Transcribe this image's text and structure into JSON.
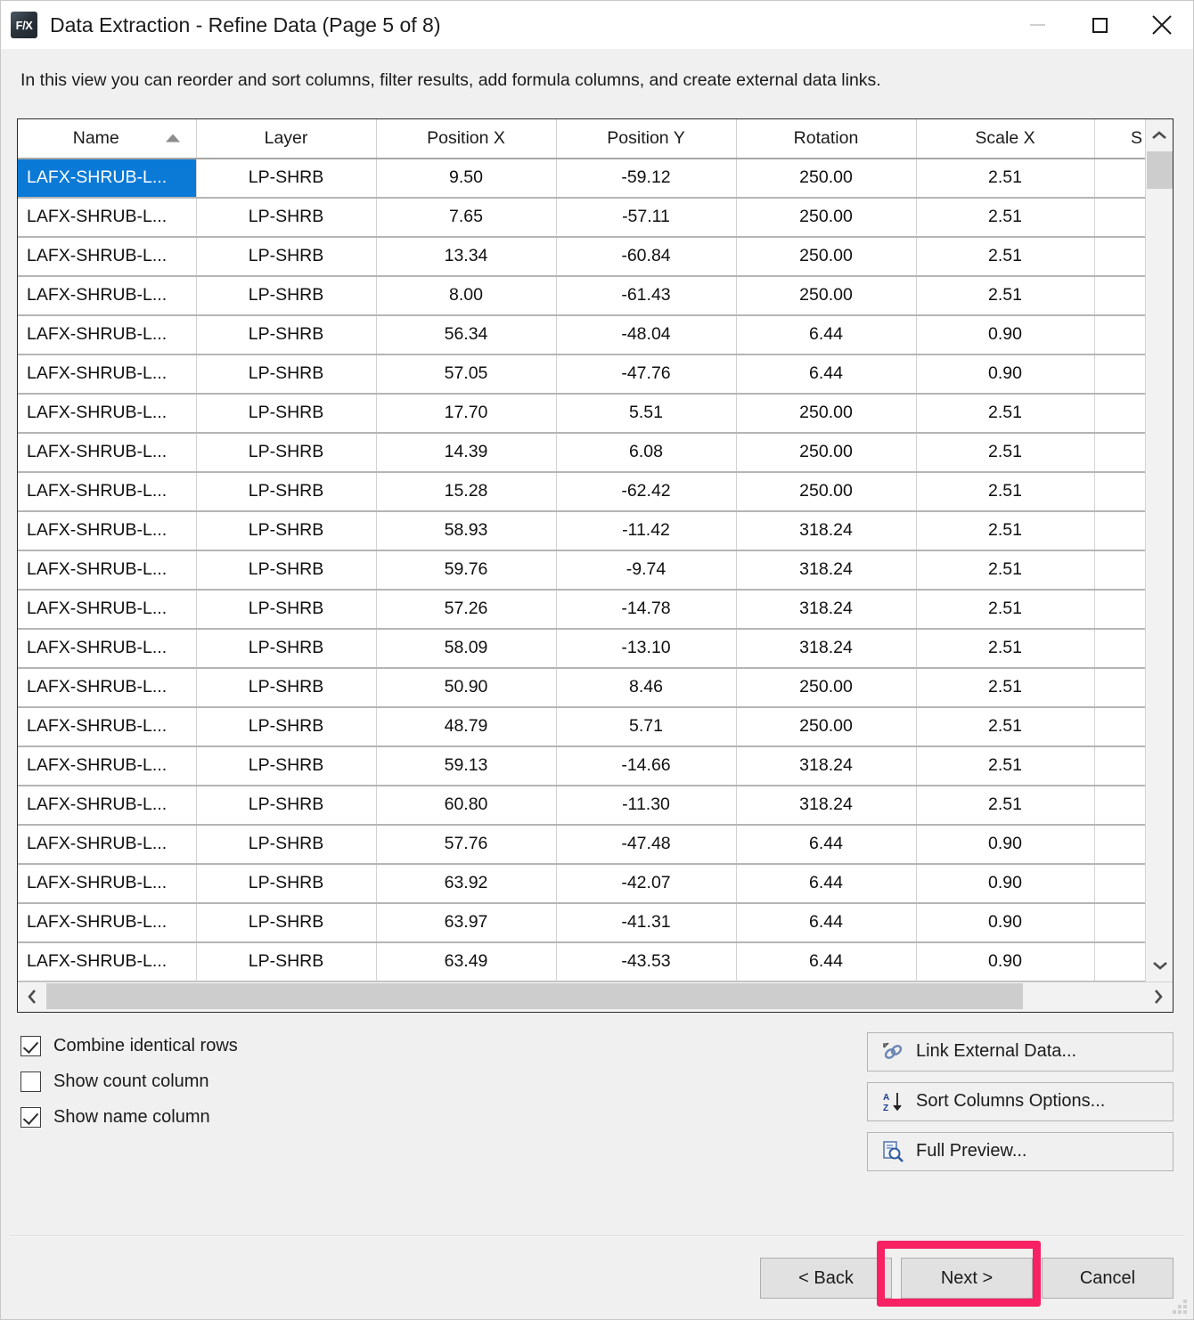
{
  "window": {
    "app_icon_label": "F/X",
    "title": "Data Extraction - Refine Data (Page 5 of 8)",
    "controls": {
      "minimize": "minimize-icon",
      "maximize": "maximize-icon",
      "close": "close-icon"
    }
  },
  "description": "In this view you can reorder and sort columns, filter results, add formula columns, and create external data links.",
  "table": {
    "sort": {
      "column": "Name",
      "direction": "ascending"
    },
    "columns": [
      "Name",
      "Layer",
      "Position X",
      "Position Y",
      "Rotation",
      "Scale X",
      "S"
    ],
    "selected_row_index": 0,
    "rows": [
      {
        "name": "LAFX-SHRUB-L...",
        "layer": "LP-SHRB",
        "pos_x": "9.50",
        "pos_y": "-59.12",
        "rotation": "250.00",
        "scale_x": "2.51",
        "scale_s": ""
      },
      {
        "name": "LAFX-SHRUB-L...",
        "layer": "LP-SHRB",
        "pos_x": "7.65",
        "pos_y": "-57.11",
        "rotation": "250.00",
        "scale_x": "2.51",
        "scale_s": ""
      },
      {
        "name": "LAFX-SHRUB-L...",
        "layer": "LP-SHRB",
        "pos_x": "13.34",
        "pos_y": "-60.84",
        "rotation": "250.00",
        "scale_x": "2.51",
        "scale_s": ""
      },
      {
        "name": "LAFX-SHRUB-L...",
        "layer": "LP-SHRB",
        "pos_x": "8.00",
        "pos_y": "-61.43",
        "rotation": "250.00",
        "scale_x": "2.51",
        "scale_s": ""
      },
      {
        "name": "LAFX-SHRUB-L...",
        "layer": "LP-SHRB",
        "pos_x": "56.34",
        "pos_y": "-48.04",
        "rotation": "6.44",
        "scale_x": "0.90",
        "scale_s": ""
      },
      {
        "name": "LAFX-SHRUB-L...",
        "layer": "LP-SHRB",
        "pos_x": "57.05",
        "pos_y": "-47.76",
        "rotation": "6.44",
        "scale_x": "0.90",
        "scale_s": ""
      },
      {
        "name": "LAFX-SHRUB-L...",
        "layer": "LP-SHRB",
        "pos_x": "17.70",
        "pos_y": "5.51",
        "rotation": "250.00",
        "scale_x": "2.51",
        "scale_s": ""
      },
      {
        "name": "LAFX-SHRUB-L...",
        "layer": "LP-SHRB",
        "pos_x": "14.39",
        "pos_y": "6.08",
        "rotation": "250.00",
        "scale_x": "2.51",
        "scale_s": ""
      },
      {
        "name": "LAFX-SHRUB-L...",
        "layer": "LP-SHRB",
        "pos_x": "15.28",
        "pos_y": "-62.42",
        "rotation": "250.00",
        "scale_x": "2.51",
        "scale_s": ""
      },
      {
        "name": "LAFX-SHRUB-L...",
        "layer": "LP-SHRB",
        "pos_x": "58.93",
        "pos_y": "-11.42",
        "rotation": "318.24",
        "scale_x": "2.51",
        "scale_s": ""
      },
      {
        "name": "LAFX-SHRUB-L...",
        "layer": "LP-SHRB",
        "pos_x": "59.76",
        "pos_y": "-9.74",
        "rotation": "318.24",
        "scale_x": "2.51",
        "scale_s": ""
      },
      {
        "name": "LAFX-SHRUB-L...",
        "layer": "LP-SHRB",
        "pos_x": "57.26",
        "pos_y": "-14.78",
        "rotation": "318.24",
        "scale_x": "2.51",
        "scale_s": ""
      },
      {
        "name": "LAFX-SHRUB-L...",
        "layer": "LP-SHRB",
        "pos_x": "58.09",
        "pos_y": "-13.10",
        "rotation": "318.24",
        "scale_x": "2.51",
        "scale_s": ""
      },
      {
        "name": "LAFX-SHRUB-L...",
        "layer": "LP-SHRB",
        "pos_x": "50.90",
        "pos_y": "8.46",
        "rotation": "250.00",
        "scale_x": "2.51",
        "scale_s": ""
      },
      {
        "name": "LAFX-SHRUB-L...",
        "layer": "LP-SHRB",
        "pos_x": "48.79",
        "pos_y": "5.71",
        "rotation": "250.00",
        "scale_x": "2.51",
        "scale_s": ""
      },
      {
        "name": "LAFX-SHRUB-L...",
        "layer": "LP-SHRB",
        "pos_x": "59.13",
        "pos_y": "-14.66",
        "rotation": "318.24",
        "scale_x": "2.51",
        "scale_s": ""
      },
      {
        "name": "LAFX-SHRUB-L...",
        "layer": "LP-SHRB",
        "pos_x": "60.80",
        "pos_y": "-11.30",
        "rotation": "318.24",
        "scale_x": "2.51",
        "scale_s": ""
      },
      {
        "name": "LAFX-SHRUB-L...",
        "layer": "LP-SHRB",
        "pos_x": "57.76",
        "pos_y": "-47.48",
        "rotation": "6.44",
        "scale_x": "0.90",
        "scale_s": ""
      },
      {
        "name": "LAFX-SHRUB-L...",
        "layer": "LP-SHRB",
        "pos_x": "63.92",
        "pos_y": "-42.07",
        "rotation": "6.44",
        "scale_x": "0.90",
        "scale_s": ""
      },
      {
        "name": "LAFX-SHRUB-L...",
        "layer": "LP-SHRB",
        "pos_x": "63.97",
        "pos_y": "-41.31",
        "rotation": "6.44",
        "scale_x": "0.90",
        "scale_s": ""
      },
      {
        "name": "LAFX-SHRUB-L...",
        "layer": "LP-SHRB",
        "pos_x": "63.49",
        "pos_y": "-43.53",
        "rotation": "6.44",
        "scale_x": "0.90",
        "scale_s": ""
      }
    ]
  },
  "options": {
    "checkboxes": [
      {
        "label": "Combine identical rows",
        "checked": true
      },
      {
        "label": "Show count column",
        "checked": false
      },
      {
        "label": "Show name column",
        "checked": true
      }
    ]
  },
  "side_buttons": [
    {
      "label": "Link External Data...",
      "icon": "link-chain-icon"
    },
    {
      "label": "Sort Columns Options...",
      "icon": "sort-az-icon"
    },
    {
      "label": "Full Preview...",
      "icon": "preview-magnifier-icon"
    }
  ],
  "footer": {
    "back_label": "< Back",
    "next_label": "Next >",
    "cancel_label": "Cancel",
    "highlight_color": "#f72163",
    "highlighted_button": "Next >"
  }
}
